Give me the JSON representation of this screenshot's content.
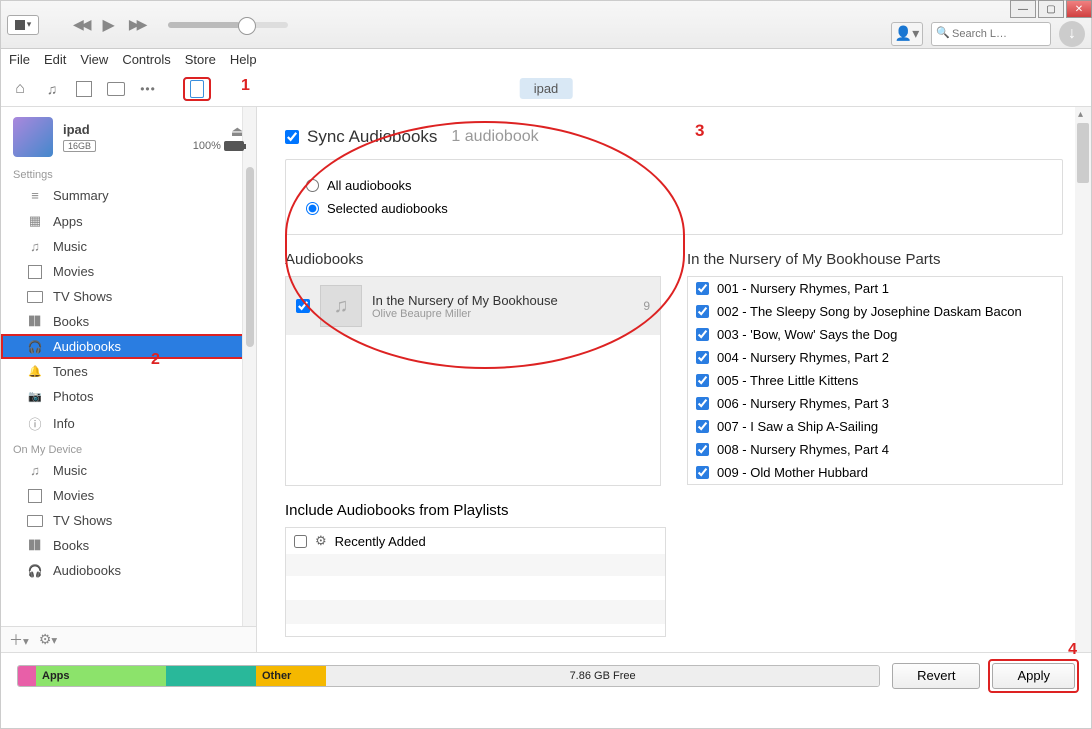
{
  "titlebar": {
    "search_placeholder": "Search L…"
  },
  "menubar": [
    "File",
    "Edit",
    "View",
    "Controls",
    "Store",
    "Help"
  ],
  "device_pill": "ipad",
  "annotations": {
    "a1": "1",
    "a2": "2",
    "a3": "3",
    "a4": "4"
  },
  "device": {
    "name": "ipad",
    "capacity": "16GB",
    "battery_pct": "100%"
  },
  "sidebar": {
    "settings_label": "Settings",
    "settings_items": [
      {
        "label": "Summary",
        "icon": "i-summary"
      },
      {
        "label": "Apps",
        "icon": "i-apps"
      },
      {
        "label": "Music",
        "icon": "i-music"
      },
      {
        "label": "Movies",
        "icon": "i-movies"
      },
      {
        "label": "TV Shows",
        "icon": "i-tv"
      },
      {
        "label": "Books",
        "icon": "i-books"
      },
      {
        "label": "Audiobooks",
        "icon": "i-audiobooks",
        "selected": true
      },
      {
        "label": "Tones",
        "icon": "i-tones"
      },
      {
        "label": "Photos",
        "icon": "i-photos"
      },
      {
        "label": "Info",
        "icon": "i-info"
      }
    ],
    "ondevice_label": "On My Device",
    "ondevice_items": [
      {
        "label": "Music",
        "icon": "i-music"
      },
      {
        "label": "Movies",
        "icon": "i-movies"
      },
      {
        "label": "TV Shows",
        "icon": "i-tv"
      },
      {
        "label": "Books",
        "icon": "i-books"
      },
      {
        "label": "Audiobooks",
        "icon": "i-audiobooks"
      }
    ]
  },
  "sync": {
    "checkbox_label": "Sync Audiobooks",
    "count_label": "1 audiobook",
    "opt_all": "All audiobooks",
    "opt_selected": "Selected audiobooks"
  },
  "audiobooks": {
    "heading": "Audiobooks",
    "items": [
      {
        "title": "In the Nursery of My Bookhouse",
        "author": "Olive Beaupre Miller",
        "count": "9",
        "checked": true
      }
    ]
  },
  "parts": {
    "heading": "In the Nursery of My Bookhouse Parts",
    "items": [
      "001 - Nursery Rhymes, Part 1",
      "002 - The Sleepy Song by Josephine Daskam Bacon",
      "003 - 'Bow, Wow' Says the Dog",
      "004 - Nursery Rhymes, Part 2",
      "005 - Three Little Kittens",
      "006 - Nursery Rhymes, Part 3",
      "007 - I Saw a Ship A-Sailing",
      "008 - Nursery Rhymes, Part 4",
      "009 - Old Mother Hubbard"
    ]
  },
  "playlists": {
    "heading": "Include Audiobooks from Playlists",
    "items": [
      "Recently Added"
    ]
  },
  "storage": {
    "apps": "Apps",
    "other": "Other",
    "free": "7.86 GB Free"
  },
  "buttons": {
    "revert": "Revert",
    "apply": "Apply"
  }
}
